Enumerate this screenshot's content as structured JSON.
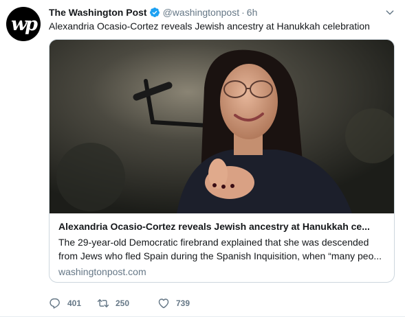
{
  "tweet": {
    "avatar_text": "wp",
    "display_name": "The Washington Post",
    "handle": "@washingtonpost",
    "separator": "·",
    "time": "6h",
    "text": "Alexandria Ocasio-Cortez reveals Jewish ancestry at Hanukkah celebration"
  },
  "card": {
    "title": "Alexandria Ocasio-Cortez reveals Jewish ancestry at Hanukkah ce...",
    "description_line1": "The 29-year-old Democratic firebrand explained that she was descended",
    "description_line2": "from Jews who fled Spain during the Spanish Inquisition, when “many peo...",
    "domain": "washingtonpost.com"
  },
  "actions": {
    "replies": "401",
    "retweets": "250",
    "likes": "739"
  },
  "colors": {
    "text": "#14171a",
    "muted": "#657786",
    "verified": "#1da1f2",
    "border": "#ccd6dd"
  },
  "icons": [
    "verified-icon",
    "chevron-down-icon",
    "reply-icon",
    "retweet-icon",
    "like-icon"
  ]
}
